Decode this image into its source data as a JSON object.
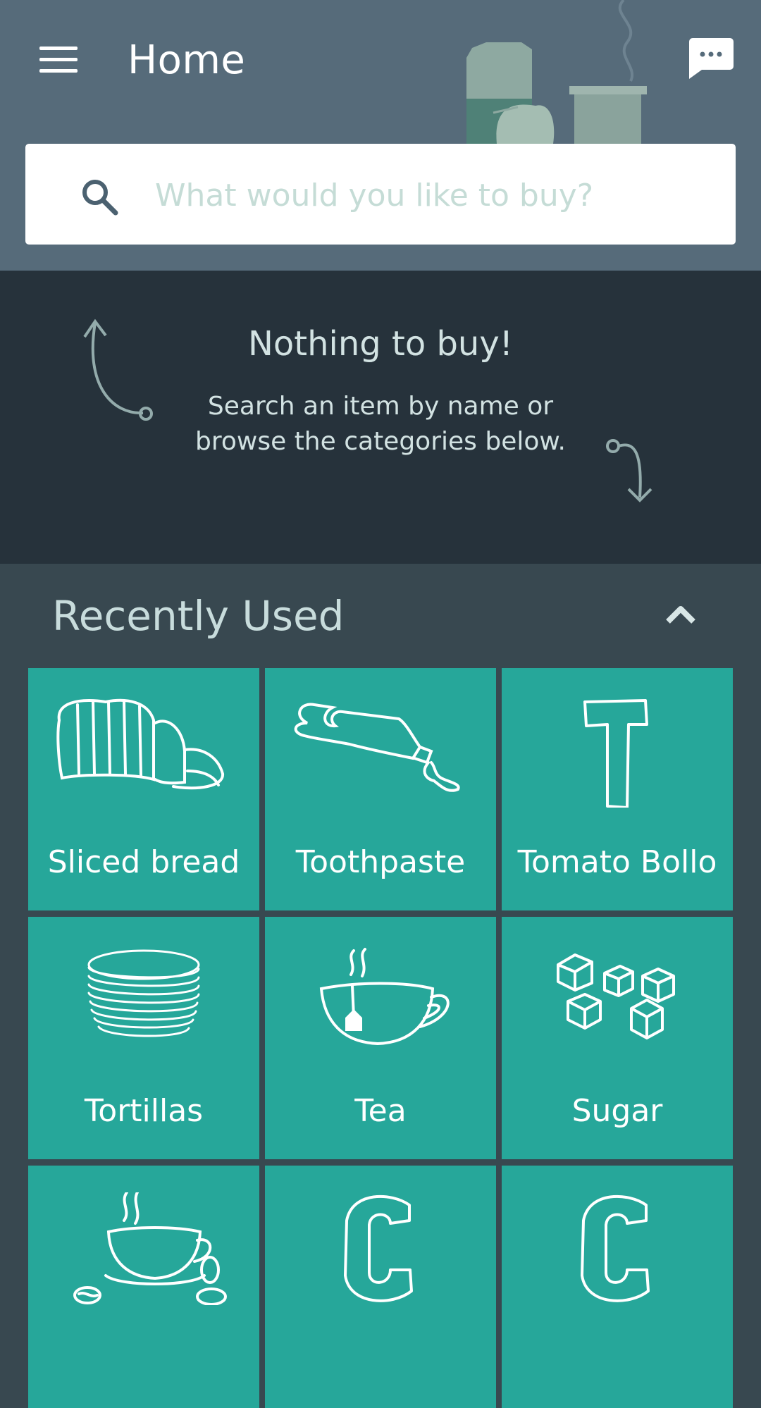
{
  "app": {
    "title": "Home"
  },
  "header": {
    "menu_icon": "hamburger-menu-icon",
    "chat_icon": "chat-bubble-icon"
  },
  "search": {
    "placeholder": "What would you like to buy?",
    "icon": "search-icon"
  },
  "empty_state": {
    "title": "Nothing to buy!",
    "subtitle_line1": "Search an item by name or",
    "subtitle_line2": "browse the categories below."
  },
  "recently_used": {
    "title": "Recently Used",
    "collapse_icon": "chevron-up-icon",
    "items": [
      {
        "label": "Sliced bread",
        "icon": "bread-icon"
      },
      {
        "label": "Toothpaste",
        "icon": "toothpaste-icon"
      },
      {
        "label": "Tomato Bollo",
        "icon": "letter-t-icon"
      },
      {
        "label": "Tortillas",
        "icon": "tortillas-icon"
      },
      {
        "label": "Tea",
        "icon": "tea-cup-icon"
      },
      {
        "label": "Sugar",
        "icon": "sugar-cubes-icon"
      },
      {
        "label": "",
        "icon": "coffee-cup-icon"
      },
      {
        "label": "",
        "icon": "letter-c-icon"
      },
      {
        "label": "",
        "icon": "letter-c-icon"
      }
    ]
  },
  "colors": {
    "header_bg": "#566b7a",
    "empty_bg": "#26323b",
    "section_bg": "#384850",
    "tile_bg": "#26a79a"
  }
}
